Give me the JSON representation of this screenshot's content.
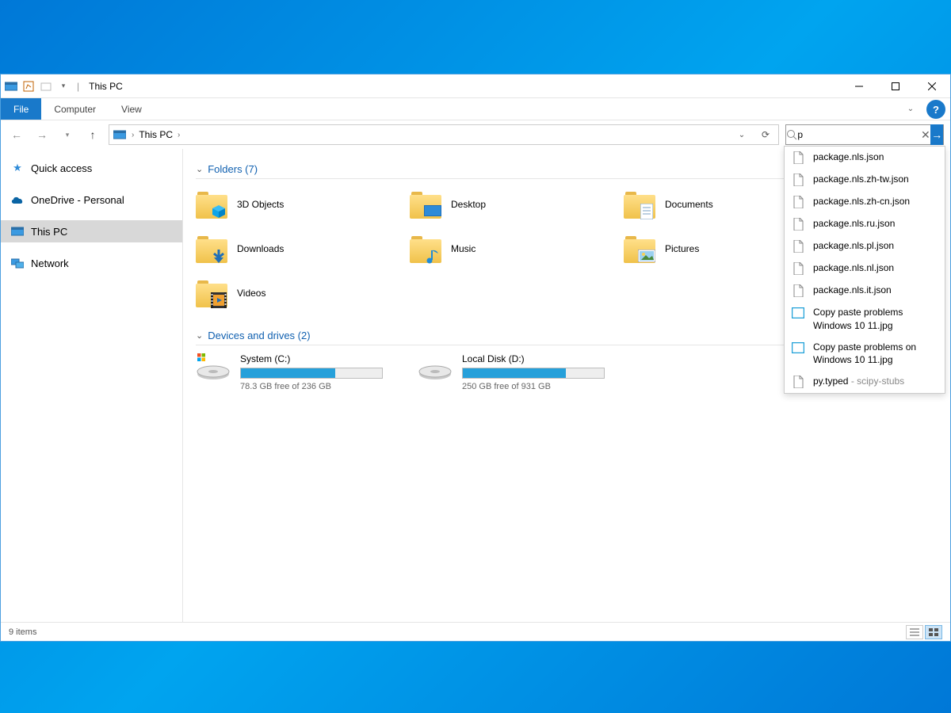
{
  "titlebar": {
    "title": "This PC"
  },
  "ribbon": {
    "tabs": {
      "file": "File",
      "computer": "Computer",
      "view": "View"
    }
  },
  "address": {
    "crumb_root": "This PC",
    "crumb_sep": "›"
  },
  "search": {
    "value": "p",
    "results": [
      {
        "icon": "file",
        "text": "package.nls.json"
      },
      {
        "icon": "file",
        "text": "package.nls.zh-tw.json"
      },
      {
        "icon": "file",
        "text": "package.nls.zh-cn.json"
      },
      {
        "icon": "file",
        "text": "package.nls.ru.json"
      },
      {
        "icon": "file",
        "text": "package.nls.pl.json"
      },
      {
        "icon": "file",
        "text": "package.nls.nl.json"
      },
      {
        "icon": "file",
        "text": "package.nls.it.json"
      },
      {
        "icon": "image",
        "text": "Copy paste problems Windows 10 11.jpg"
      },
      {
        "icon": "image",
        "text": "Copy paste problems on Windows 10 11.jpg"
      },
      {
        "icon": "file",
        "text": "py.typed",
        "sub": "- scipy-stubs"
      }
    ]
  },
  "sidebar": {
    "quick_access": "Quick access",
    "onedrive": "OneDrive - Personal",
    "this_pc": "This PC",
    "network": "Network"
  },
  "groups": {
    "folders_header": "Folders (7)",
    "drives_header": "Devices and drives (2)"
  },
  "folders": [
    {
      "name": "3D Objects",
      "overlay": "cube"
    },
    {
      "name": "Desktop",
      "overlay": "desktop"
    },
    {
      "name": "Documents",
      "overlay": "doc"
    },
    {
      "name": "Downloads",
      "overlay": "download"
    },
    {
      "name": "Music",
      "overlay": "music"
    },
    {
      "name": "Pictures",
      "overlay": "picture"
    },
    {
      "name": "Videos",
      "overlay": "video"
    }
  ],
  "drives": [
    {
      "name": "System (C:)",
      "free_text": "78.3 GB free of 236 GB",
      "fill_pct": 67,
      "os": true
    },
    {
      "name": "Local Disk (D:)",
      "free_text": "250 GB free of 931 GB",
      "fill_pct": 73,
      "os": false
    }
  ],
  "status": {
    "items": "9 items"
  }
}
